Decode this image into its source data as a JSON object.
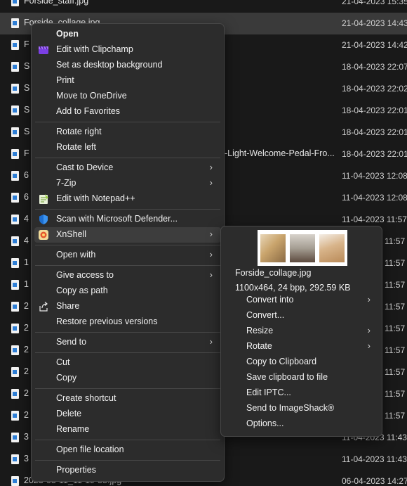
{
  "files": [
    {
      "name": "Forside_staff.jpg",
      "date": "21-04-2023 15:35",
      "selected": false
    },
    {
      "name": "Forside_collage.jpg",
      "date": "21-04-2023 14:43",
      "selected": true
    },
    {
      "name": "F",
      "date": "21-04-2023 14:42",
      "selected": false
    },
    {
      "name": "S",
      "date": "18-04-2023 22:07",
      "selected": false
    },
    {
      "name": "S",
      "date": "18-04-2023 22:02",
      "selected": false
    },
    {
      "name": "S",
      "date": "18-04-2023 22:01",
      "selected": false
    },
    {
      "name": "S",
      "date": "18-04-2023 22:01",
      "selected": false
    },
    {
      "name": "F",
      "name_tail": "-Light-Welcome-Pedal-Fro...",
      "date": "18-04-2023 22:01",
      "selected": false
    },
    {
      "name": "6",
      "date": "11-04-2023 12:08",
      "selected": false
    },
    {
      "name": "6",
      "date": "11-04-2023 12:08",
      "selected": false
    },
    {
      "name": "4",
      "date": "11-04-2023 11:57",
      "selected": false
    },
    {
      "name": "4",
      "date": "11:57",
      "selected": false
    },
    {
      "name": "1",
      "date": "11:57",
      "selected": false
    },
    {
      "name": "1",
      "date": "11:57",
      "selected": false
    },
    {
      "name": "2",
      "date": "11:57",
      "selected": false
    },
    {
      "name": "2",
      "date": "11:57",
      "selected": false
    },
    {
      "name": "2",
      "date": "11:57",
      "selected": false
    },
    {
      "name": "2",
      "date": "11:57",
      "selected": false
    },
    {
      "name": "2",
      "date": "11:57",
      "selected": false
    },
    {
      "name": "2",
      "date": "11:57",
      "selected": false
    },
    {
      "name": "3",
      "date": "11-04-2023 11:43",
      "selected": false
    },
    {
      "name": "3",
      "date": "11-04-2023 11:43",
      "selected": false
    },
    {
      "name": "2023-03-11_11-19-55.jpg",
      "date": "06-04-2023 14:27",
      "selected": false
    }
  ],
  "context_menu": {
    "items": [
      {
        "label": "Open",
        "bold": true,
        "icon": ""
      },
      {
        "label": "Edit with Clipchamp",
        "icon": "clipchamp-icon"
      },
      {
        "label": "Set as desktop background",
        "icon": ""
      },
      {
        "label": "Print",
        "icon": ""
      },
      {
        "label": "Move to OneDrive",
        "icon": ""
      },
      {
        "label": "Add to Favorites",
        "icon": ""
      },
      {
        "separator": true
      },
      {
        "label": "Rotate right",
        "icon": ""
      },
      {
        "label": "Rotate left",
        "icon": ""
      },
      {
        "separator": true
      },
      {
        "label": "Cast to Device",
        "submenu": true,
        "icon": ""
      },
      {
        "label": "7-Zip",
        "submenu": true,
        "icon": ""
      },
      {
        "label": "Edit with Notepad++",
        "icon": "notepadpp-icon"
      },
      {
        "separator": true
      },
      {
        "label": "Scan with Microsoft Defender...",
        "icon": "defender-shield-icon"
      },
      {
        "label": "XnShell",
        "submenu": true,
        "hover": true,
        "icon": "xnshell-icon"
      },
      {
        "separator": true
      },
      {
        "label": "Open with",
        "submenu": true,
        "icon": ""
      },
      {
        "separator": true
      },
      {
        "label": "Give access to",
        "submenu": true,
        "icon": ""
      },
      {
        "label": "Copy as path",
        "icon": ""
      },
      {
        "label": "Share",
        "icon": "share-icon"
      },
      {
        "label": "Restore previous versions",
        "icon": ""
      },
      {
        "separator": true
      },
      {
        "label": "Send to",
        "submenu": true,
        "icon": ""
      },
      {
        "separator": true
      },
      {
        "label": "Cut",
        "icon": ""
      },
      {
        "label": "Copy",
        "icon": ""
      },
      {
        "separator": true
      },
      {
        "label": "Create shortcut",
        "icon": ""
      },
      {
        "label": "Delete",
        "icon": ""
      },
      {
        "label": "Rename",
        "icon": ""
      },
      {
        "separator": true
      },
      {
        "label": "Open file location",
        "icon": ""
      },
      {
        "separator": true
      },
      {
        "label": "Properties",
        "icon": ""
      }
    ],
    "submenu_chevron": "›"
  },
  "xnshell_menu": {
    "file_name": "Forside_collage.jpg",
    "file_info": "1100x464, 24 bpp, 292.59 KB",
    "items": [
      {
        "label": "Convert into",
        "submenu": true
      },
      {
        "label": "Convert...",
        "submenu": false
      },
      {
        "label": "Resize",
        "submenu": true
      },
      {
        "label": "Rotate",
        "submenu": true
      },
      {
        "label": "Copy to Clipboard",
        "submenu": false
      },
      {
        "label": "Save clipboard to file",
        "submenu": false
      },
      {
        "label": "Edit IPTC...",
        "submenu": false
      },
      {
        "label": "Send to ImageShack®",
        "submenu": false
      },
      {
        "label": "Options...",
        "submenu": false
      }
    ]
  },
  "colors": {
    "background": "#191919",
    "menu_background": "#2c2c2c",
    "menu_border": "#474747",
    "hover": "#3d3d3d",
    "selected_row": "#3a3a3a"
  }
}
